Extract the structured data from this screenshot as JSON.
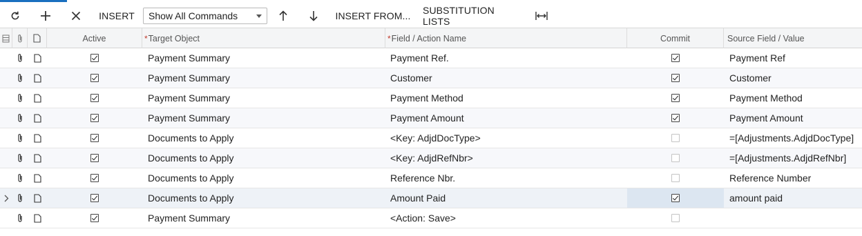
{
  "toolbar": {
    "insert_label": "INSERT",
    "filter_selected": "Show All Commands",
    "insert_from_label": "INSERT FROM...",
    "substitution_label": "SUBSTITUTION LISTS"
  },
  "columns": {
    "active": "Active",
    "target_object": "Target Object",
    "field_action": "Field / Action Name",
    "commit": "Commit",
    "source_field": "Source Field / Value",
    "required_mark": "*"
  },
  "rows": [
    {
      "active": true,
      "target": "Payment Summary",
      "field": "Payment Ref.",
      "commit": true,
      "source": "Payment Ref"
    },
    {
      "active": true,
      "target": "Payment Summary",
      "field": "Customer",
      "commit": true,
      "source": "Customer"
    },
    {
      "active": true,
      "target": "Payment Summary",
      "field": "Payment Method",
      "commit": true,
      "source": "Payment Method"
    },
    {
      "active": true,
      "target": "Payment Summary",
      "field": "Payment Amount",
      "commit": true,
      "source": "Payment Amount"
    },
    {
      "active": true,
      "target": "Documents to Apply",
      "field": "<Key: AdjdDocType>",
      "commit": false,
      "source": "=[Adjustments.AdjdDocType]"
    },
    {
      "active": true,
      "target": "Documents to Apply",
      "field": "<Key: AdjdRefNbr>",
      "commit": false,
      "source": "=[Adjustments.AdjdRefNbr]"
    },
    {
      "active": true,
      "target": "Documents to Apply",
      "field": "Reference Nbr.",
      "commit": false,
      "source": "Reference Number"
    },
    {
      "active": true,
      "target": "Documents to Apply",
      "field": "Amount Paid",
      "commit": true,
      "source": "amount paid",
      "selected": true
    },
    {
      "active": true,
      "target": "Payment Summary",
      "field": "<Action: Save>",
      "commit": false,
      "source": ""
    }
  ]
}
